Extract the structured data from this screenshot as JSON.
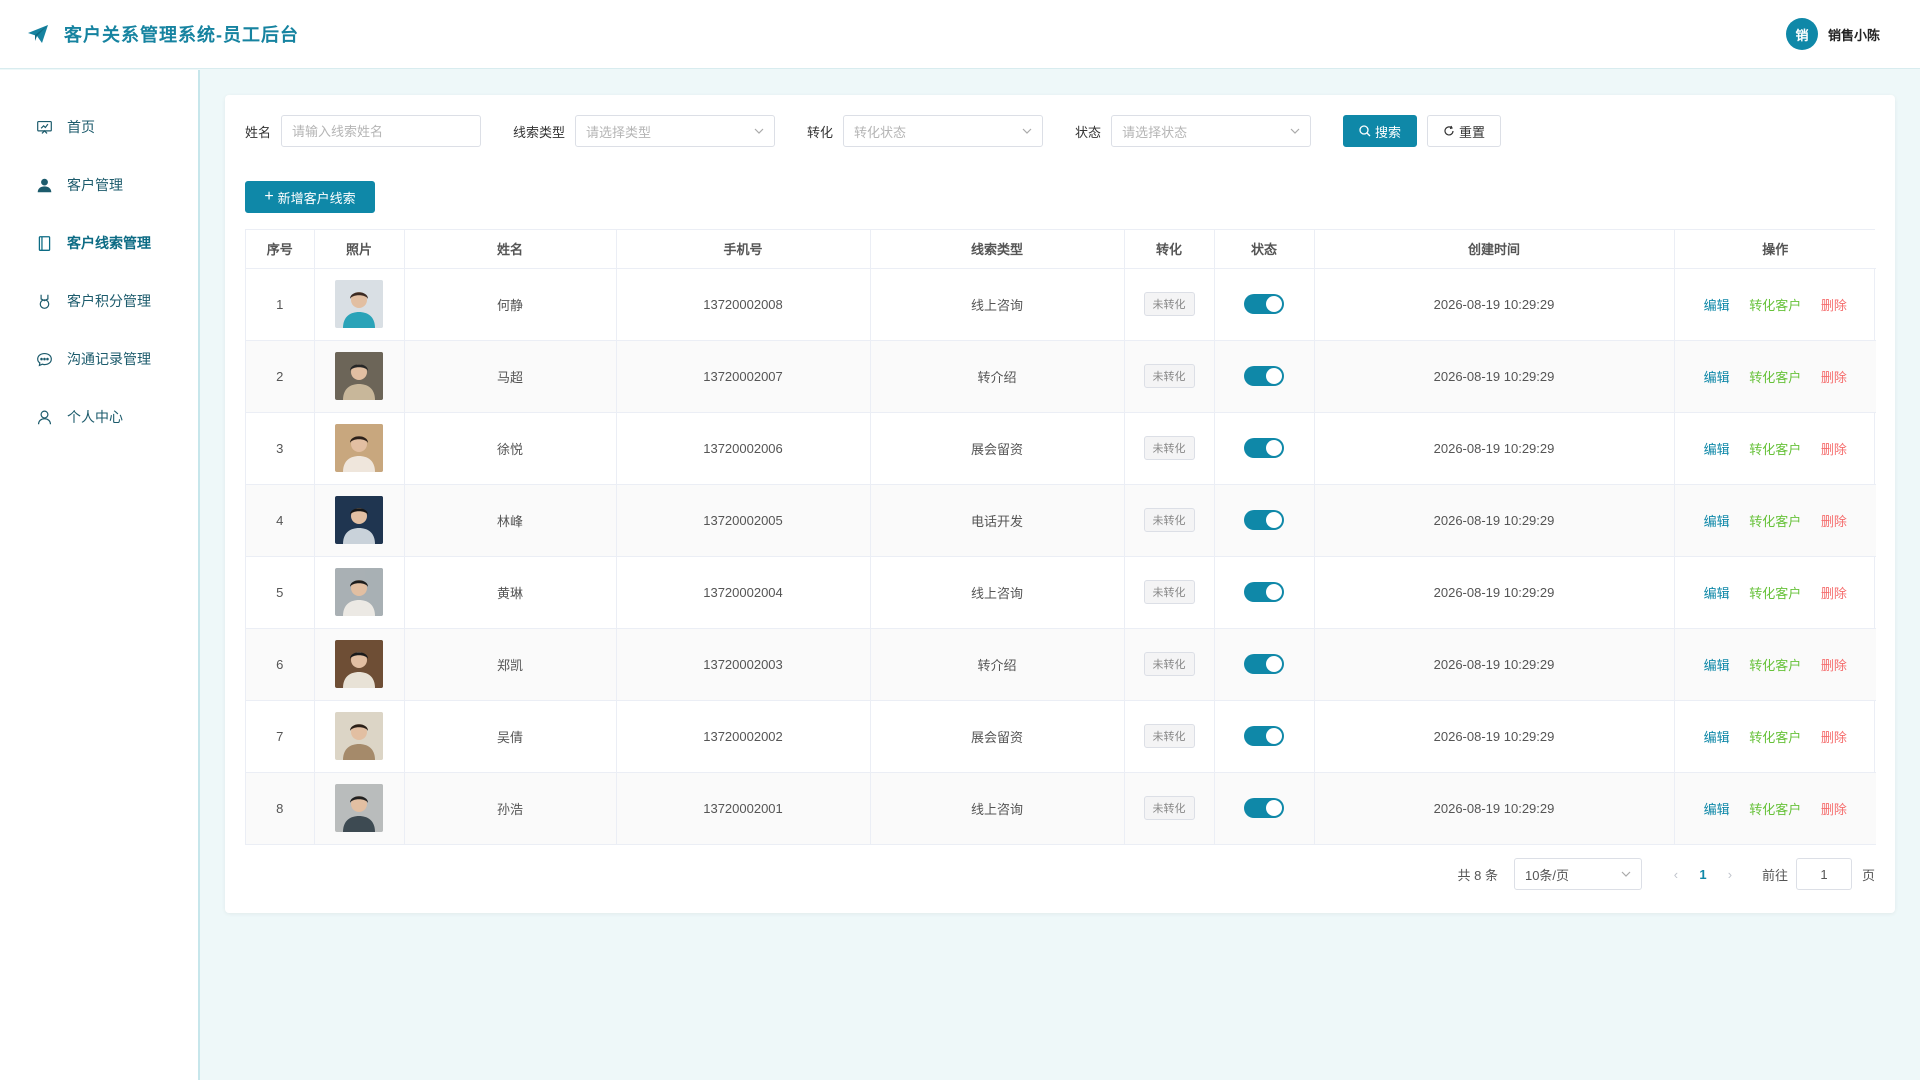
{
  "header": {
    "title": "客户关系管理系统-员工后台",
    "user_avatar": "销",
    "user_name": "销售小陈"
  },
  "sidebar": {
    "items": [
      {
        "label": "首页",
        "icon": "dashboard-icon",
        "active": false
      },
      {
        "label": "客户管理",
        "icon": "user-icon",
        "active": false
      },
      {
        "label": "客户线索管理",
        "icon": "book-icon",
        "active": true
      },
      {
        "label": "客户积分管理",
        "icon": "medal-icon",
        "active": false
      },
      {
        "label": "沟通记录管理",
        "icon": "chat-icon",
        "active": false
      },
      {
        "label": "个人中心",
        "icon": "user-outline-icon",
        "active": false
      }
    ]
  },
  "filters": {
    "name_label": "姓名",
    "name_placeholder": "请输入线索姓名",
    "type_label": "线索类型",
    "type_placeholder": "请选择类型",
    "convert_label": "转化",
    "convert_placeholder": "转化状态",
    "status_label": "状态",
    "status_placeholder": "请选择状态",
    "search_label": "搜索",
    "reset_label": "重置"
  },
  "add_button": "新增客户线索",
  "table": {
    "columns": [
      "序号",
      "照片",
      "姓名",
      "手机号",
      "线索类型",
      "转化",
      "状态",
      "创建时间",
      "操作"
    ],
    "rows": [
      {
        "index": "1",
        "name": "何静",
        "phone": "13720002008",
        "type": "线上咨询",
        "convert": "未转化",
        "status": true,
        "created": "2026-08-19 10:29:29"
      },
      {
        "index": "2",
        "name": "马超",
        "phone": "13720002007",
        "type": "转介绍",
        "convert": "未转化",
        "status": true,
        "created": "2026-08-19 10:29:29"
      },
      {
        "index": "3",
        "name": "徐悦",
        "phone": "13720002006",
        "type": "展会留资",
        "convert": "未转化",
        "status": true,
        "created": "2026-08-19 10:29:29"
      },
      {
        "index": "4",
        "name": "林峰",
        "phone": "13720002005",
        "type": "电话开发",
        "convert": "未转化",
        "status": true,
        "created": "2026-08-19 10:29:29"
      },
      {
        "index": "5",
        "name": "黄琳",
        "phone": "13720002004",
        "type": "线上咨询",
        "convert": "未转化",
        "status": true,
        "created": "2026-08-19 10:29:29"
      },
      {
        "index": "6",
        "name": "郑凯",
        "phone": "13720002003",
        "type": "转介绍",
        "convert": "未转化",
        "status": true,
        "created": "2026-08-19 10:29:29"
      },
      {
        "index": "7",
        "name": "吴倩",
        "phone": "13720002002",
        "type": "展会留资",
        "convert": "未转化",
        "status": true,
        "created": "2026-08-19 10:29:29"
      },
      {
        "index": "8",
        "name": "孙浩",
        "phone": "13720002001",
        "type": "线上咨询",
        "convert": "未转化",
        "status": true,
        "created": "2026-08-19 10:29:29"
      }
    ],
    "actions": {
      "edit": "编辑",
      "convert": "转化客户",
      "delete": "删除"
    }
  },
  "pagination": {
    "total_text": "共 8 条",
    "page_size": "10条/页",
    "current_page": "1",
    "goto_label": "前往",
    "goto_value": "1",
    "page_suffix": "页"
  },
  "colors": {
    "primary": "#0f88a8",
    "success": "#67c23a",
    "danger": "#f56c6c",
    "background": "#eef8f9"
  }
}
